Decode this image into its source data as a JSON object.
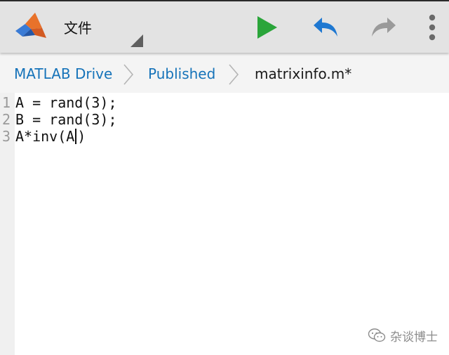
{
  "toolbar": {
    "logo_icon": "matlab-logo-icon",
    "file_menu_label": "文件",
    "run_icon": "play-icon",
    "undo_icon": "undo-icon",
    "redo_icon": "redo-icon",
    "more_icon": "more-vertical-icon",
    "colors": {
      "run": "#2aa53a",
      "undo": "#1f78d1",
      "redo": "#9a9a9a"
    }
  },
  "breadcrumb": {
    "items": [
      {
        "label": "MATLAB Drive"
      },
      {
        "label": "Published"
      },
      {
        "label": "matrixinfo.m*"
      }
    ],
    "link_color": "#1673b9"
  },
  "editor": {
    "lines": [
      {
        "number": "1",
        "code": "A = rand(3);"
      },
      {
        "number": "2",
        "code": "B = rand(3);"
      },
      {
        "number": "3",
        "code_before_caret": "A*inv(A",
        "code_after_caret": ")"
      }
    ]
  },
  "watermark": {
    "text": "杂谈博士",
    "icon": "wechat-icon"
  }
}
